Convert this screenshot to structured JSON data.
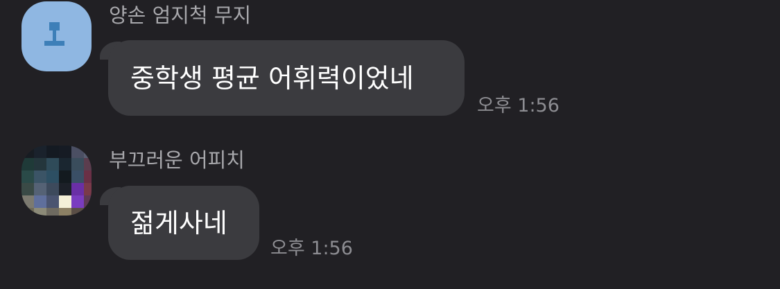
{
  "messages": [
    {
      "sender": "양손 엄지척 무지",
      "text": "중학생 평균 어휘력이었네",
      "time": "오후 1:56",
      "avatar": "muzi-thumbs-up-profile"
    },
    {
      "sender": "부끄러운 어피치",
      "text": "젊게사네",
      "time": "오후 1:56",
      "avatar": "pixelated-profile-photo"
    }
  ],
  "colors": {
    "background": "#212024",
    "bubble": "#3b3b3f",
    "sender_text": "#a8a8ac",
    "time_text": "#8d8d92",
    "avatar_1": "#8fb7e2"
  }
}
